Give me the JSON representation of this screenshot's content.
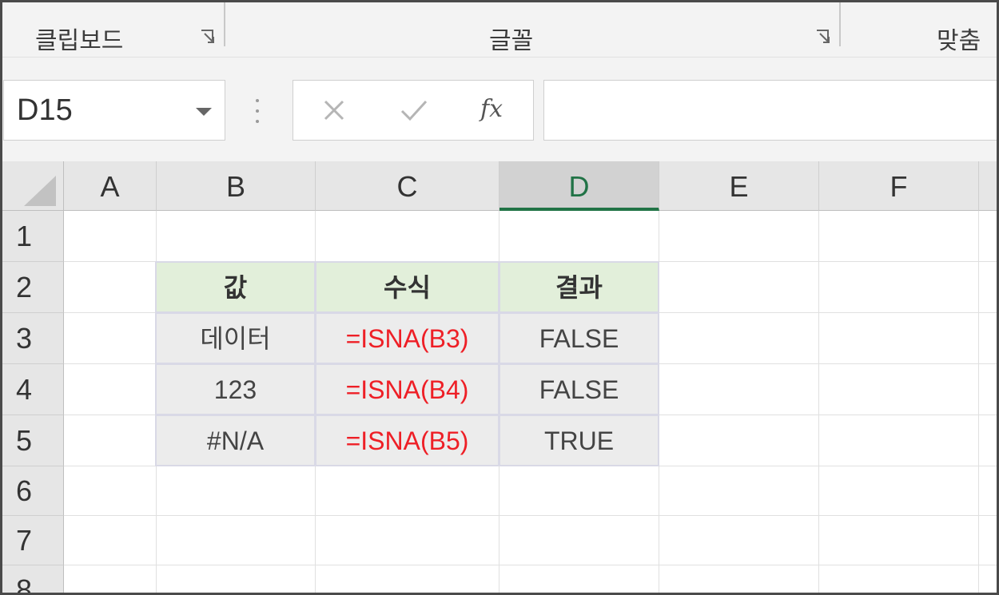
{
  "ribbon": {
    "groups": [
      {
        "label": "클립보드"
      },
      {
        "label": "글꼴"
      },
      {
        "label": "맞춤"
      }
    ]
  },
  "formula_bar": {
    "name_box": "D15",
    "cancel_icon": "x-icon",
    "enter_icon": "check-icon",
    "fx_label": "fx",
    "formula_value": ""
  },
  "grid": {
    "columns": [
      "A",
      "B",
      "C",
      "D",
      "E",
      "F"
    ],
    "selected_column": "D",
    "rows": [
      "1",
      "2",
      "3",
      "4",
      "5",
      "6",
      "7",
      "8"
    ],
    "table": {
      "header": {
        "value": "값",
        "formula": "수식",
        "result": "결과"
      },
      "data": [
        {
          "value": "데이터",
          "formula": "=ISNA(B3)",
          "result": "FALSE"
        },
        {
          "value": "123",
          "formula": "=ISNA(B4)",
          "result": "FALSE"
        },
        {
          "value": "#N/A",
          "formula": "=ISNA(B5)",
          "result": "TRUE"
        }
      ]
    }
  },
  "colors": {
    "accent": "#217346",
    "header_fill": "#e2efda",
    "formula_text": "#ee1f26"
  }
}
